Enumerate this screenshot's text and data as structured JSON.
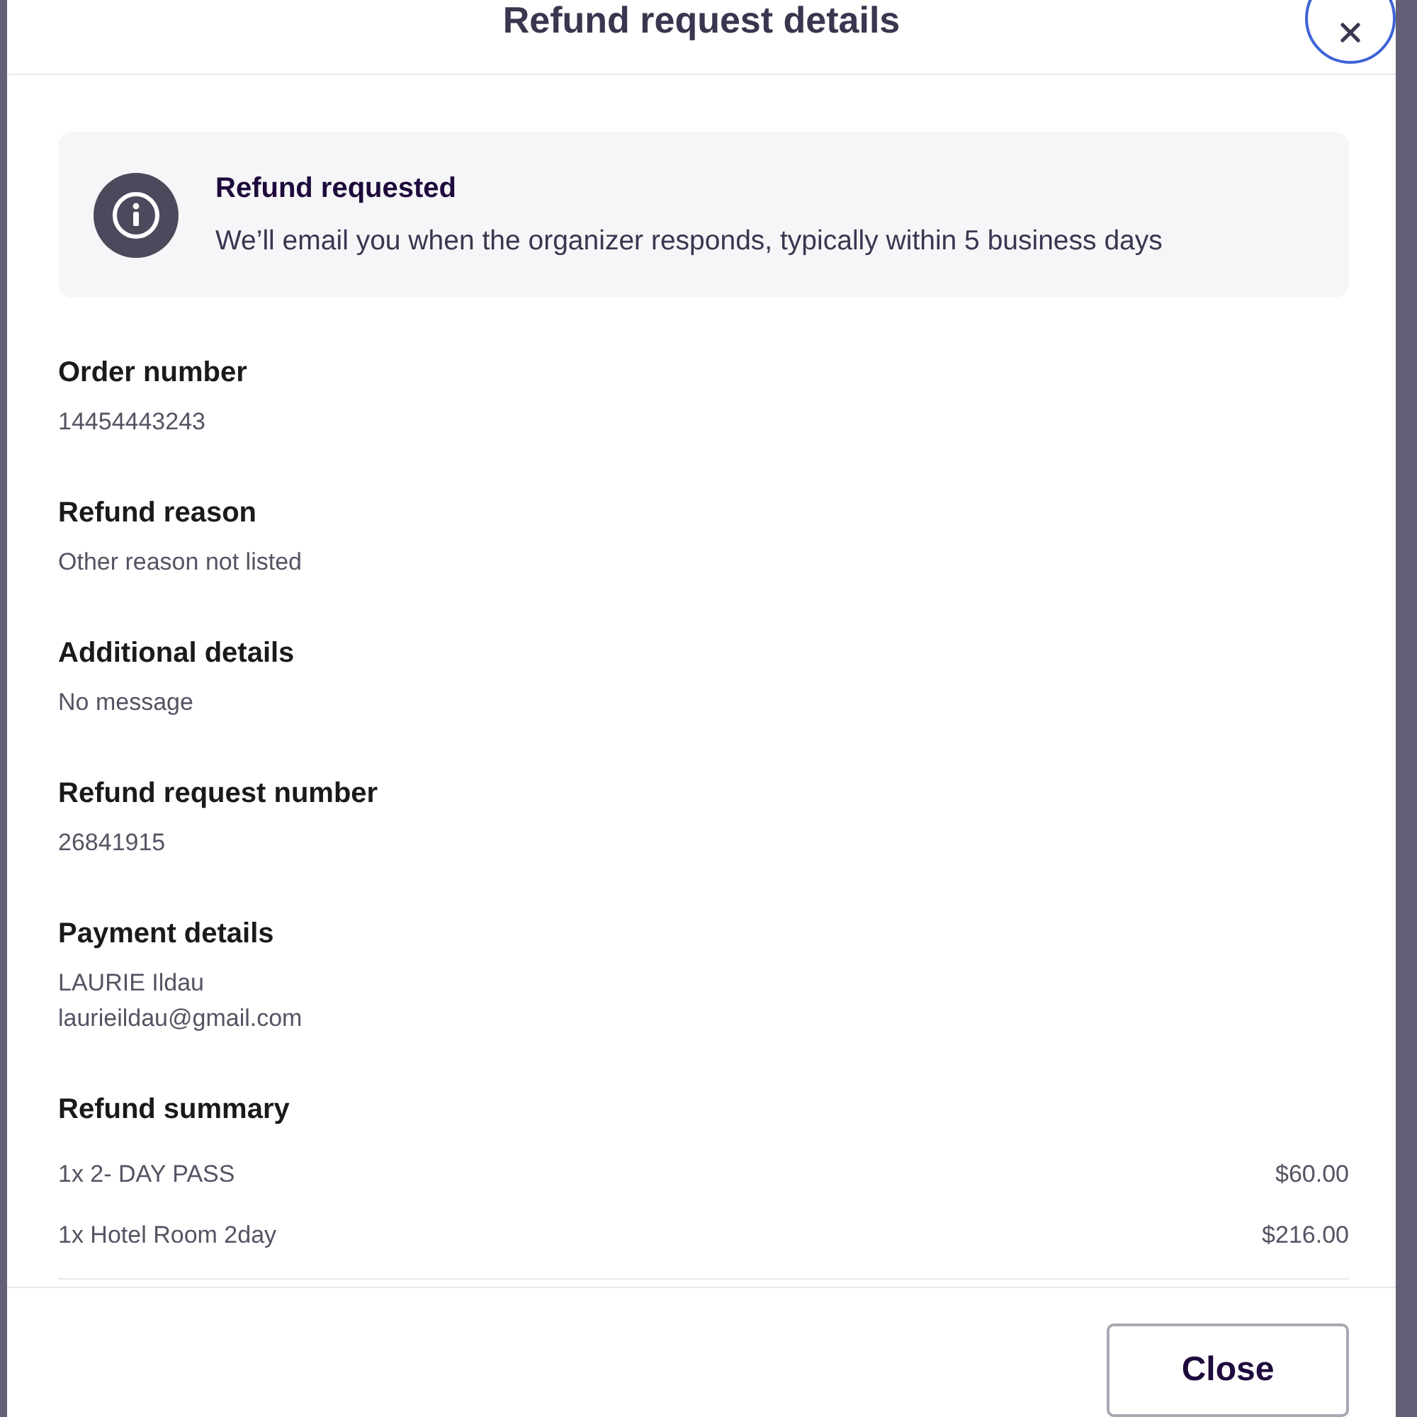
{
  "dialog": {
    "title": "Refund request details",
    "close_button": {
      "focused": true
    }
  },
  "notice": {
    "title": "Refund requested",
    "message": "We’ll email you when the organizer responds, typically within 5 business days"
  },
  "sections": [
    {
      "heading": "Order number",
      "lines": [
        "14454443243"
      ]
    },
    {
      "heading": "Refund reason",
      "lines": [
        "Other reason not listed"
      ]
    },
    {
      "heading": "Additional details",
      "lines": [
        "No message"
      ]
    },
    {
      "heading": "Refund request number",
      "lines": [
        "26841915"
      ]
    },
    {
      "heading": "Payment details",
      "lines": [
        "LAURIE Ildau",
        "laurieildau@gmail.com"
      ]
    }
  ],
  "refund_summary": {
    "heading": "Refund summary",
    "items": [
      {
        "description": "1x 2- DAY PASS",
        "amount": "$60.00"
      },
      {
        "description": "1x Hotel Room 2day",
        "amount": "$216.00"
      }
    ]
  },
  "footer": {
    "buttons": [
      {
        "label": "Close"
      }
    ]
  }
}
